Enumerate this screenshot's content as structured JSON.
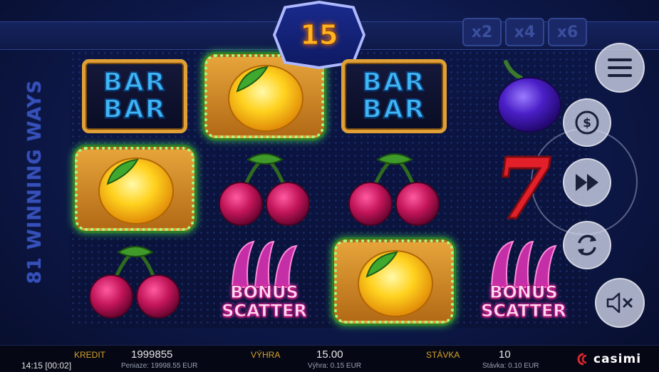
{
  "game": {
    "winning_ways": "81 WINNING WAYS",
    "multiplier_value": "15",
    "multipliers": [
      "x2",
      "x4",
      "x6"
    ]
  },
  "reels": {
    "symbols": {
      "bar": "BAR",
      "bonus_line1": "BONUS",
      "bonus_line2": "SCATTER",
      "seven": "7"
    },
    "grid": [
      [
        "bar",
        "lemon",
        "bar",
        "plum"
      ],
      [
        "lemon",
        "cherry",
        "cherry",
        "seven"
      ],
      [
        "cherry",
        "bonus-scatter",
        "lemon",
        "bonus-scatter"
      ]
    ],
    "winning_cells": [
      [
        0,
        1
      ],
      [
        1,
        0
      ],
      [
        2,
        2
      ]
    ]
  },
  "controls": {
    "menu": "menu-icon",
    "bet": "coin-dollar-icon",
    "spin": "fast-forward-icon",
    "autoplay": "refresh-icon",
    "sound": "mute-icon",
    "bet_symbol": "$"
  },
  "status_bar": {
    "time": "14:15 [00:02]",
    "kredit_label": "KREDIT",
    "kredit_value": "1999855",
    "kredit_sub": "Peniaze: 19998.55 EUR",
    "vyhra_label": "VÝHRA",
    "vyhra_value": "15.00",
    "vyhra_sub": "Výhra: 0.15 EUR",
    "stavka_label": "STÁVKA",
    "stavka_value": "10",
    "stavka_sub": "Stávka: 0.10 EUR",
    "brand": "casimi"
  },
  "colors": {
    "win_frame": "#9dff8a",
    "accent": "#ffb424",
    "label": "#d7a12a"
  }
}
